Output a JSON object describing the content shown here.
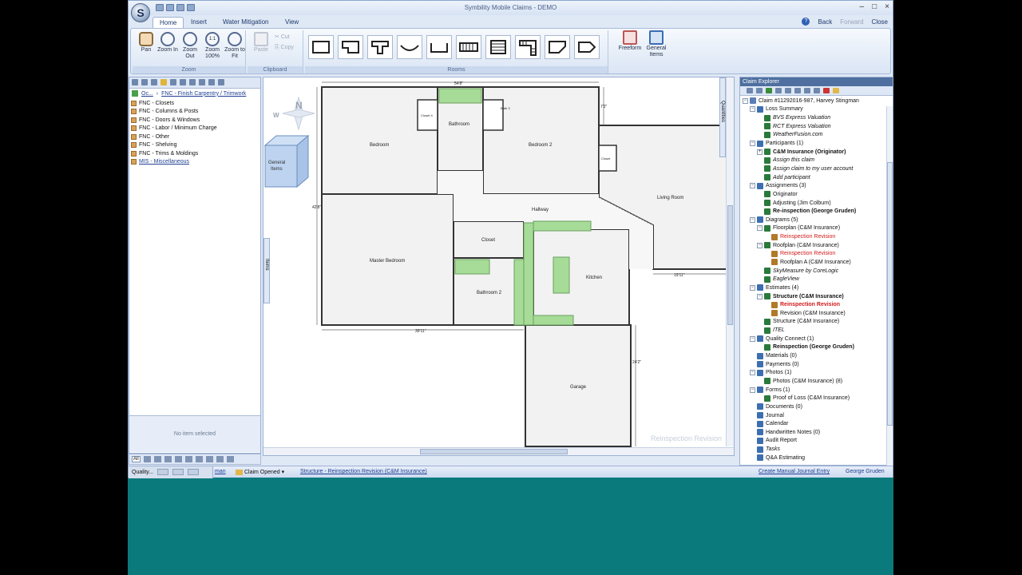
{
  "window": {
    "title": "Symbility Mobile Claims - DEMO",
    "nav_back": "Back",
    "nav_forward": "Forward",
    "nav_close": "Close"
  },
  "tabs": [
    "Home",
    "Insert",
    "Water Mitigation",
    "View"
  ],
  "ribbon": {
    "zoom_group": "Zoom",
    "clipboard_group": "Clipboard",
    "rooms_group": "Rooms",
    "pan": "Pan",
    "zoom_in": "Zoom In",
    "zoom_out": "Zoom Out",
    "zoom_100": "Zoom 100%",
    "zoom_fit": "Zoom to Fit",
    "paste": "Paste",
    "cut": "Cut",
    "copy": "Copy",
    "freeform": "Freeform",
    "general_items": "General Items",
    "zoom_100_glyph": "1:1"
  },
  "left_panel": {
    "crumb_root": "Oc...",
    "crumb_current": "FNC - Finish Carpentry / Trimwork",
    "items": [
      "FNC - Closets",
      "FNC - Columns & Posts",
      "FNC - Doors & Windows",
      "FNC - Labor / Minimum Charge",
      "FNC - Other",
      "FNC - Shelving",
      "FNC - Trims & Moldings",
      "MIS - Miscellaneous"
    ],
    "no_item": "No item selected",
    "all_label": "All",
    "items_tab": "Items"
  },
  "canvas": {
    "watermark": "Reinspection Revision",
    "quantities_tab": "Quantities",
    "general_items": "General Items",
    "compass_north": "N",
    "compass_west": "W",
    "dims": {
      "top": "54'8\"",
      "bottom": "39'11\"",
      "left": "42'8\"",
      "right_top": "7'2\"",
      "living_bottom": "19'11\"",
      "garage_right": "24'2\""
    },
    "rooms": {
      "bedroom": "Bedroom",
      "closet1": "Closet 4",
      "bathroom": "Bathroom",
      "closet3": "Bath 3",
      "bedroom2": "Bedroom 2",
      "closet_small": "Closet",
      "hallway": "Hallway",
      "living": "Living Room",
      "master": "Master Bedroom",
      "closet": "Closet",
      "bathroom2": "Bathroom 2",
      "kitchen": "Kitchen",
      "garage": "Garage"
    }
  },
  "explorer": {
    "title": "Claim Explorer",
    "tree": [
      {
        "level": 0,
        "text": "Claim #11292016-987, Harvey Stingman",
        "exp": "-",
        "style": ""
      },
      {
        "level": 1,
        "text": "Loss Summary",
        "exp": "-",
        "style": ""
      },
      {
        "level": 2,
        "text": "BVS Express Valuation",
        "exp": "",
        "style": "italic"
      },
      {
        "level": 2,
        "text": "RCT Express Valuation",
        "exp": "",
        "style": "italic"
      },
      {
        "level": 2,
        "text": "WeatherFusion.com",
        "exp": "",
        "style": "italic"
      },
      {
        "level": 1,
        "text": "Participants (1)",
        "exp": "-",
        "style": ""
      },
      {
        "level": 2,
        "text": "C&M Insurance (Originator)",
        "exp": "+",
        "style": "bold"
      },
      {
        "level": 2,
        "text": "Assign this claim",
        "exp": "",
        "style": "italic"
      },
      {
        "level": 2,
        "text": "Assign claim to my user account",
        "exp": "",
        "style": "italic"
      },
      {
        "level": 2,
        "text": "Add participant",
        "exp": "",
        "style": "italic"
      },
      {
        "level": 1,
        "text": "Assignments (3)",
        "exp": "-",
        "style": ""
      },
      {
        "level": 2,
        "text": "Originator",
        "exp": "",
        "style": ""
      },
      {
        "level": 2,
        "text": "Adjusting (Jim Colburn)",
        "exp": "",
        "style": ""
      },
      {
        "level": 2,
        "text": "Re-inspection (George Gruden)",
        "exp": "",
        "style": "bold"
      },
      {
        "level": 1,
        "text": "Diagrams (5)",
        "exp": "-",
        "style": ""
      },
      {
        "level": 2,
        "text": "Floorplan (C&M Insurance)",
        "exp": "-",
        "style": ""
      },
      {
        "level": 3,
        "text": "Reinspection Revision",
        "exp": "",
        "style": "red"
      },
      {
        "level": 2,
        "text": "Roofplan (C&M Insurance)",
        "exp": "-",
        "style": ""
      },
      {
        "level": 3,
        "text": "Reinspection Revision",
        "exp": "",
        "style": "red"
      },
      {
        "level": 3,
        "text": "Roofplan A (C&M Insurance)",
        "exp": "",
        "style": ""
      },
      {
        "level": 2,
        "text": "SkyMeasure by CoreLogic",
        "exp": "",
        "style": "italic"
      },
      {
        "level": 2,
        "text": "EagleView",
        "exp": "",
        "style": "italic"
      },
      {
        "level": 1,
        "text": "Estimates (4)",
        "exp": "-",
        "style": ""
      },
      {
        "level": 2,
        "text": "Structure (C&M Insurance)",
        "exp": "-",
        "style": "bold"
      },
      {
        "level": 3,
        "text": "Reinspection Revision",
        "exp": "",
        "style": "red bold"
      },
      {
        "level": 3,
        "text": "Revision (C&M Insurance)",
        "exp": "",
        "style": ""
      },
      {
        "level": 2,
        "text": "Structure (C&M Insurance)",
        "exp": "",
        "style": ""
      },
      {
        "level": 2,
        "text": "ITEL",
        "exp": "",
        "style": "italic"
      },
      {
        "level": 1,
        "text": "Quality Connect (1)",
        "exp": "-",
        "style": ""
      },
      {
        "level": 2,
        "text": "Reinspection (George Gruden)",
        "exp": "",
        "style": "bold"
      },
      {
        "level": 1,
        "text": "Materials (0)",
        "exp": "",
        "style": ""
      },
      {
        "level": 1,
        "text": "Payments (0)",
        "exp": "",
        "style": ""
      },
      {
        "level": 1,
        "text": "Photos (1)",
        "exp": "-",
        "style": ""
      },
      {
        "level": 2,
        "text": "Photos (C&M Insurance) (8)",
        "exp": "",
        "style": ""
      },
      {
        "level": 1,
        "text": "Forms (1)",
        "exp": "-",
        "style": ""
      },
      {
        "level": 2,
        "text": "Proof of Loss (C&M Insurance)",
        "exp": "",
        "style": ""
      },
      {
        "level": 1,
        "text": "Documents (0)",
        "exp": "",
        "style": ""
      },
      {
        "level": 1,
        "text": "Journal",
        "exp": "",
        "style": ""
      },
      {
        "level": 1,
        "text": "Calendar",
        "exp": "",
        "style": ""
      },
      {
        "level": 1,
        "text": "Handwritten Notes (0)",
        "exp": "",
        "style": ""
      },
      {
        "level": 1,
        "text": "Audit Report",
        "exp": "",
        "style": ""
      },
      {
        "level": 1,
        "text": "Tasks",
        "exp": "",
        "style": "italic"
      },
      {
        "level": 1,
        "text": "Q&A Estimating",
        "exp": "",
        "style": ""
      }
    ]
  },
  "status": {
    "quality": "Quality...",
    "user_fragment": "man",
    "claim_state": "Claim Opened",
    "structure_link": "Structure - Reinspection Revision (C&M Insurance)",
    "journal_link": "Create Manual Journal Entry",
    "user": "George Gruden"
  },
  "colors": {
    "teal_background": "#0b7a7d",
    "cabinet_green": "#a6dc98",
    "link_blue": "#1f3f92",
    "revision_red": "#d11a1a"
  }
}
